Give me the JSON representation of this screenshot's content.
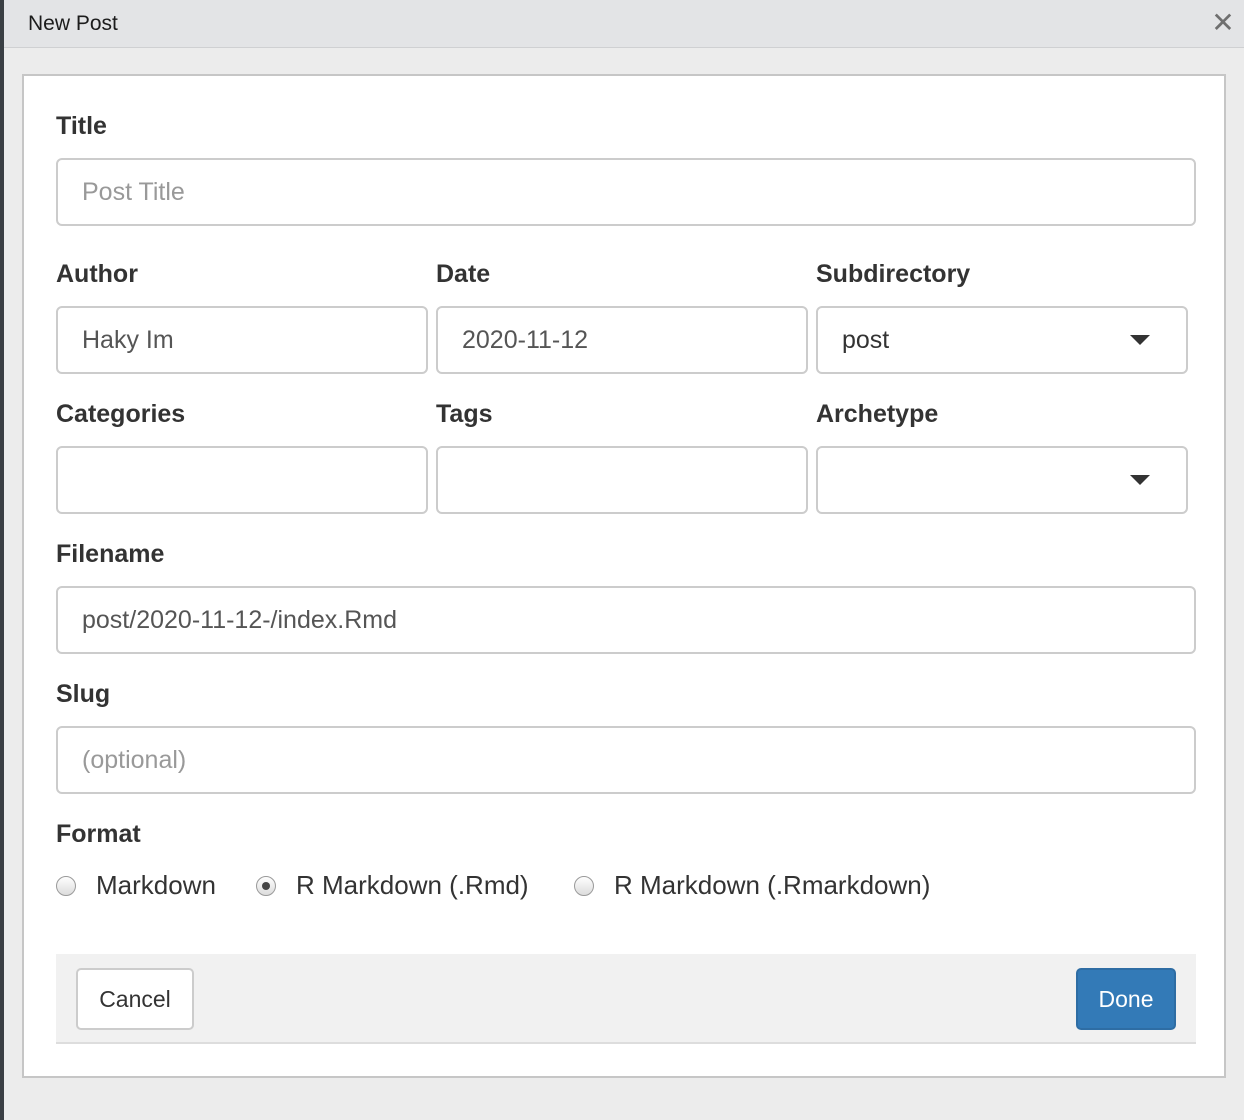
{
  "dialog": {
    "title": "New Post",
    "close_glyph": "✕"
  },
  "form": {
    "title_label": "Title",
    "title_placeholder": "Post Title",
    "title_value": "",
    "author_label": "Author",
    "author_value": "Haky Im",
    "date_label": "Date",
    "date_value": "2020-11-12",
    "subdirectory_label": "Subdirectory",
    "subdirectory_value": "post",
    "categories_label": "Categories",
    "categories_value": "",
    "tags_label": "Tags",
    "tags_value": "",
    "archetype_label": "Archetype",
    "archetype_value": "",
    "filename_label": "Filename",
    "filename_value": "post/2020-11-12-/index.Rmd",
    "slug_label": "Slug",
    "slug_placeholder": "(optional)",
    "slug_value": "",
    "format_label": "Format",
    "format_options": [
      {
        "label": "Markdown",
        "selected": false
      },
      {
        "label": "R Markdown (.Rmd)",
        "selected": true
      },
      {
        "label": "R Markdown (.Rmarkdown)",
        "selected": false
      }
    ]
  },
  "footer": {
    "cancel_label": "Cancel",
    "done_label": "Done"
  },
  "colors": {
    "primary_button": "#337ab7",
    "panel_background": "#ffffff",
    "footer_background": "#f1f1f1"
  },
  "icons": {
    "close": "close-icon",
    "dropdown": "chevron-down-icon"
  }
}
